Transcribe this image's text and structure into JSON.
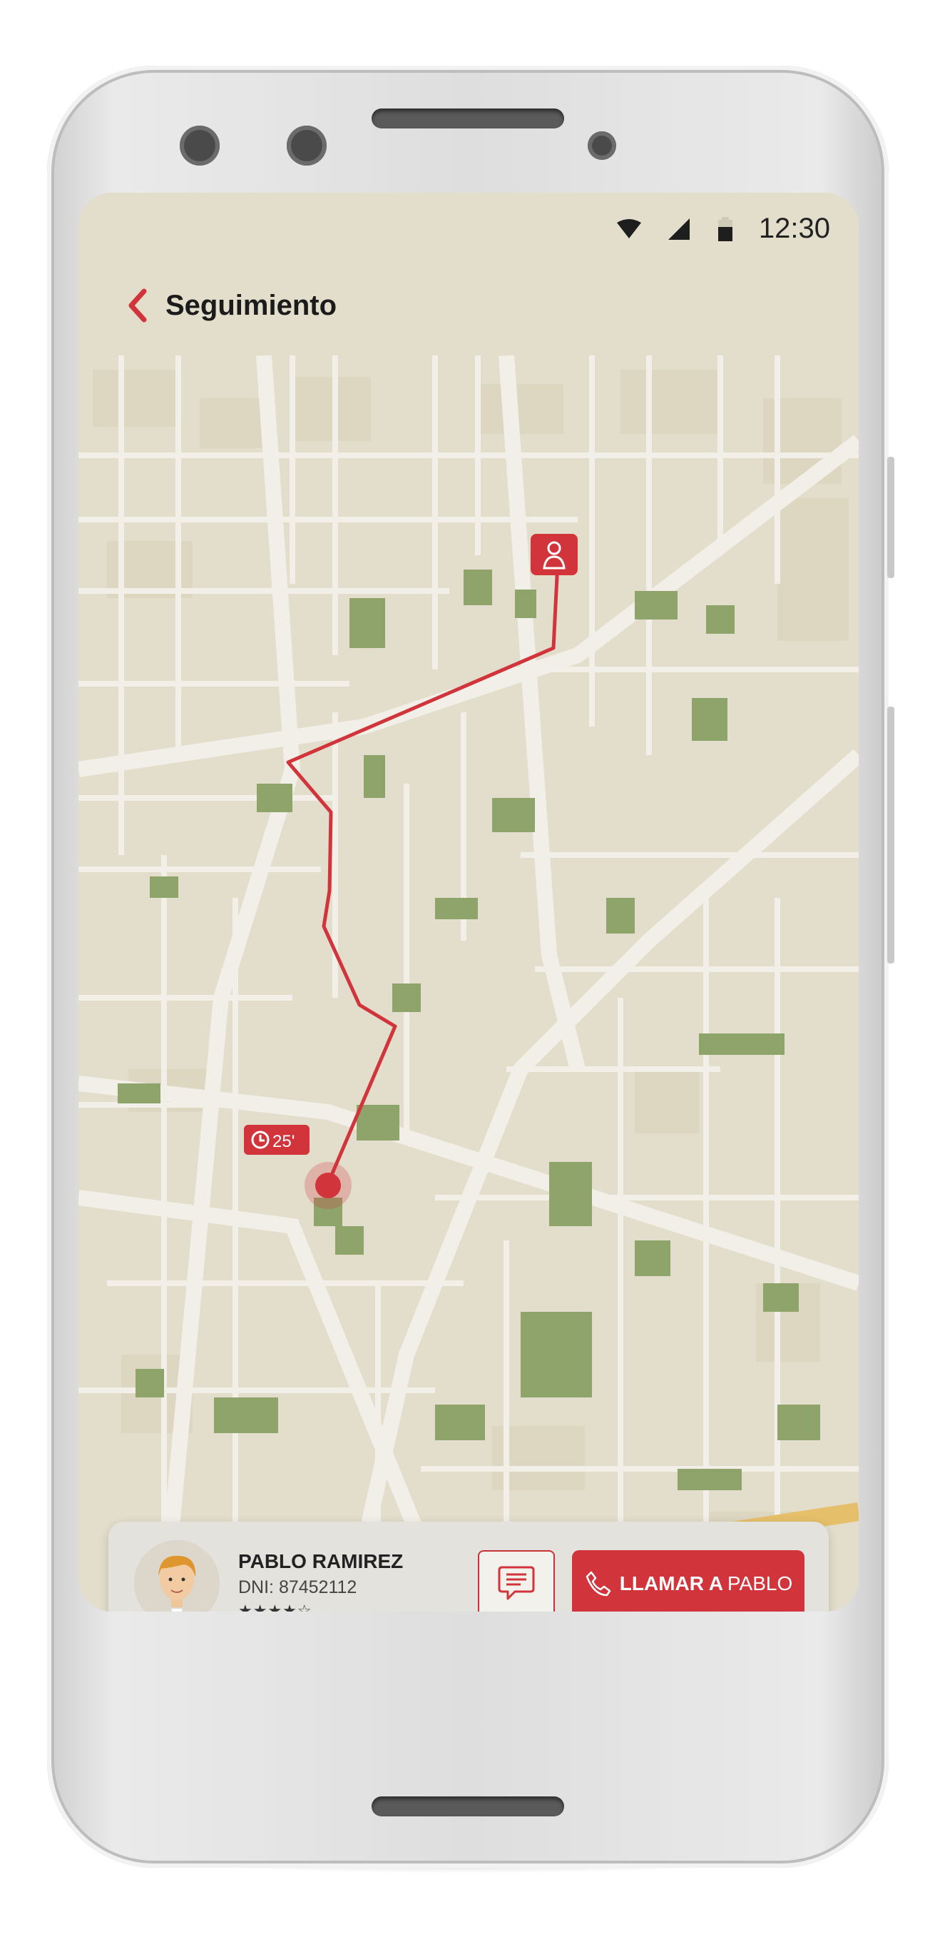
{
  "status_bar": {
    "time": "12:30"
  },
  "header": {
    "title": "Seguimiento"
  },
  "map": {
    "eta_badge": "25'",
    "route_color": "#d1343b"
  },
  "driver_card": {
    "name": "PABLO RAMIREZ",
    "dni": "DNI: 87452112",
    "rating_stars": "★★★★☆",
    "rating": 4,
    "call_button": {
      "bold": "LLAMAR A",
      "light": "PABLO"
    }
  },
  "colors": {
    "accent": "#d1343b",
    "map_background": "#e3ddcb",
    "park": "#8fa46b",
    "road": "#f1efe8"
  }
}
